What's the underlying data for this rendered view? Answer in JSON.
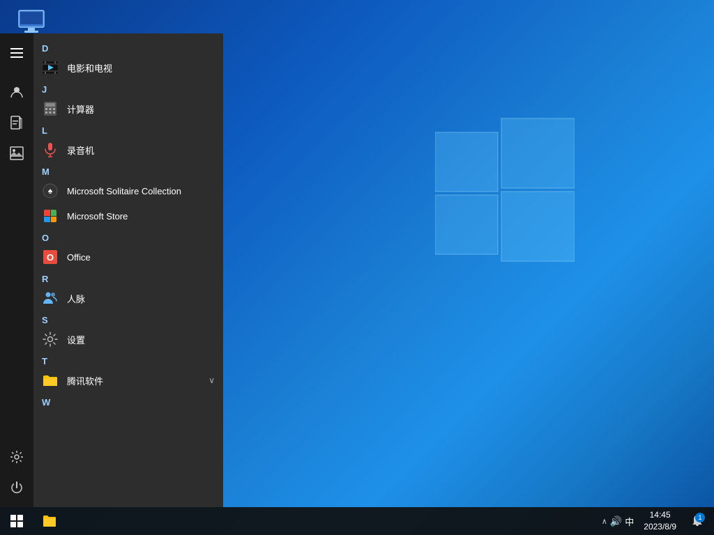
{
  "desktop": {
    "background_note": "blue gradient",
    "icon": {
      "label": "此电脑"
    }
  },
  "start_menu": {
    "hamburger_label": "☰",
    "sections": [
      {
        "letter": "D",
        "items": [
          {
            "id": "movies-tv",
            "label": "电影和电视",
            "icon_type": "film"
          }
        ]
      },
      {
        "letter": "J",
        "items": [
          {
            "id": "calculator",
            "label": "计算器",
            "icon_type": "calc"
          }
        ]
      },
      {
        "letter": "L",
        "items": [
          {
            "id": "recorder",
            "label": "录音机",
            "icon_type": "mic"
          }
        ]
      },
      {
        "letter": "M",
        "items": [
          {
            "id": "solitaire",
            "label": "Microsoft Solitaire Collection",
            "icon_type": "solitaire"
          },
          {
            "id": "store",
            "label": "Microsoft Store",
            "icon_type": "store"
          }
        ]
      },
      {
        "letter": "O",
        "items": [
          {
            "id": "office",
            "label": "Office",
            "icon_type": "office"
          }
        ]
      },
      {
        "letter": "R",
        "items": [
          {
            "id": "people",
            "label": "人脉",
            "icon_type": "people"
          }
        ]
      },
      {
        "letter": "S",
        "items": [
          {
            "id": "settings",
            "label": "设置",
            "icon_type": "settings"
          }
        ]
      },
      {
        "letter": "T",
        "items": [
          {
            "id": "tencent",
            "label": "腾讯软件",
            "icon_type": "folder",
            "has_arrow": true
          }
        ]
      },
      {
        "letter": "W",
        "items": []
      }
    ]
  },
  "taskbar": {
    "start_icon": "⊞",
    "file_explorer_label": "📁",
    "time": "14:45",
    "date": "2023/8/9",
    "systray": {
      "chevron": "∧",
      "ime": "中",
      "speaker": "🔊"
    },
    "notification_badge": "1"
  },
  "sidebar": {
    "icons": [
      {
        "id": "user",
        "symbol": "👤"
      },
      {
        "id": "document",
        "symbol": "📄"
      },
      {
        "id": "photos",
        "symbol": "🖼"
      },
      {
        "id": "settings",
        "symbol": "⚙"
      },
      {
        "id": "power",
        "symbol": "⏻"
      }
    ]
  }
}
